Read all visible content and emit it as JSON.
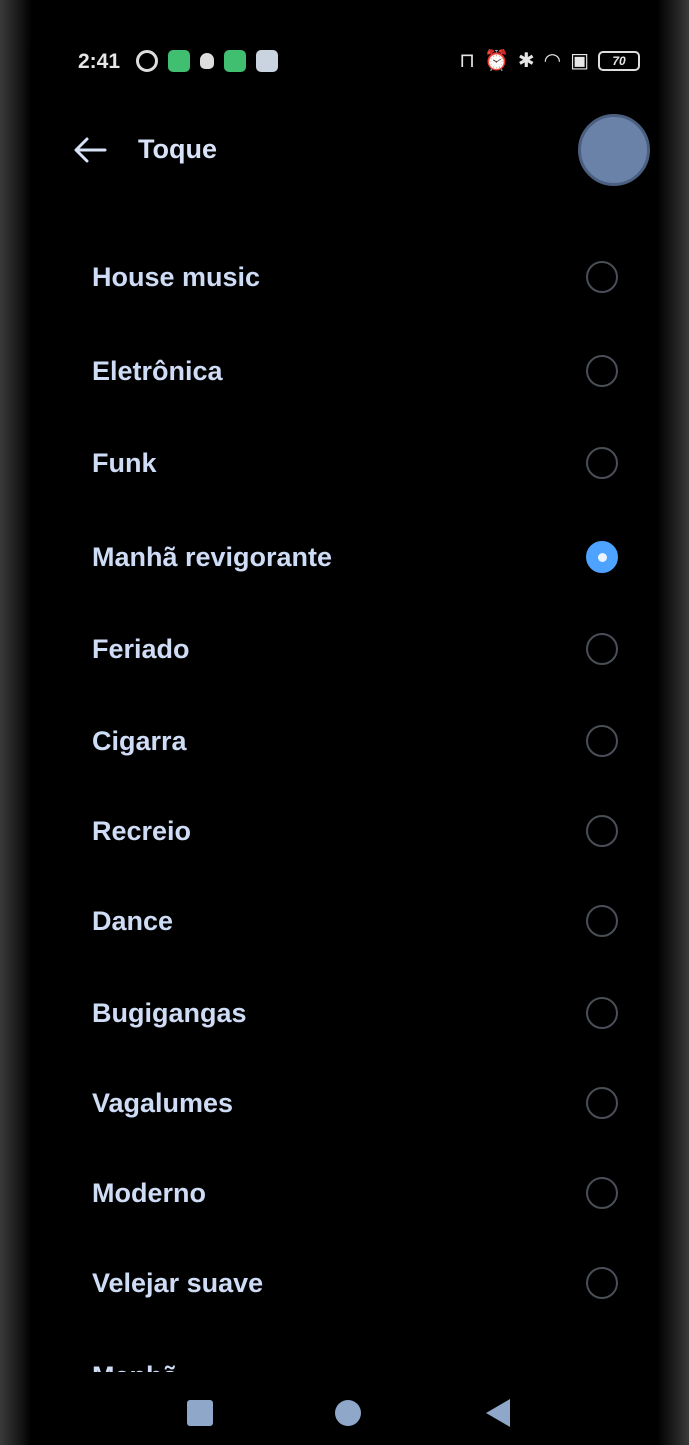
{
  "status_bar": {
    "time": "2:41",
    "left_icons": [
      "gear-icon",
      "grid-app-icon",
      "bug-icon",
      "green-app-icon",
      "card-icon"
    ],
    "right_icons": [
      "nfc-icon",
      "alarm-icon",
      "bluetooth-icon",
      "wifi-icon",
      "sim-icon"
    ],
    "battery": "70"
  },
  "header": {
    "title": "Toque"
  },
  "ringtones": [
    {
      "label": "House music",
      "selected": false
    },
    {
      "label": "Eletrônica",
      "selected": false
    },
    {
      "label": "Funk",
      "selected": false
    },
    {
      "label": "Manhã revigorante",
      "selected": true
    },
    {
      "label": "Feriado",
      "selected": false
    },
    {
      "label": "Cigarra",
      "selected": false
    },
    {
      "label": "Recreio",
      "selected": false
    },
    {
      "label": "Dance",
      "selected": false
    },
    {
      "label": "Bugigangas",
      "selected": false
    },
    {
      "label": "Vagalumes",
      "selected": false
    },
    {
      "label": "Moderno",
      "selected": false
    },
    {
      "label": "Velejar suave",
      "selected": false
    }
  ],
  "partial_item": "Manhã",
  "colors": {
    "accent": "#4da3ff",
    "text": "#cfdcf5",
    "background": "#000000"
  },
  "nav": {
    "recents_icon": "square-icon",
    "home_icon": "circle-icon",
    "back_icon": "triangle-back-icon"
  }
}
